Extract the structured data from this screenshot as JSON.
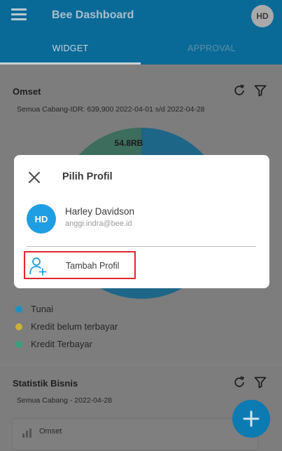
{
  "app": {
    "title": "Bee Dashboard",
    "user_initials": "HD"
  },
  "tabs": [
    {
      "label": "WIDGET",
      "active": true
    },
    {
      "label": "APPROVAL",
      "active": false
    }
  ],
  "omset": {
    "title": "Omset",
    "subtitle": "Semua Cabang-IDR: 639,900 2022-04-01 s/d 2022-04-28",
    "chart_data": {
      "type": "pie",
      "data_labels": [
        "54.8RB"
      ],
      "legend": [
        "Tunai",
        "Kredit belum terbayar",
        "Kredit Terbayar"
      ],
      "colors": [
        "#1f8fbf",
        "#c9b13a",
        "#3aa07e"
      ]
    }
  },
  "statistik": {
    "title": "Statistik Bisnis",
    "subtitle": "Semua Cabang - 2022-04-28",
    "items": [
      {
        "label": "Omset"
      }
    ]
  },
  "dialog": {
    "title": "Pilih Profil",
    "profile": {
      "initials": "HD",
      "name": "Harley Davidson",
      "email": "anggi.indra@bee.id"
    },
    "add_label": "Tambah Profil"
  },
  "colors": {
    "accent": "#1f9ee3",
    "highlight_border": "#e0282e",
    "appbar": "#0a6a97"
  }
}
